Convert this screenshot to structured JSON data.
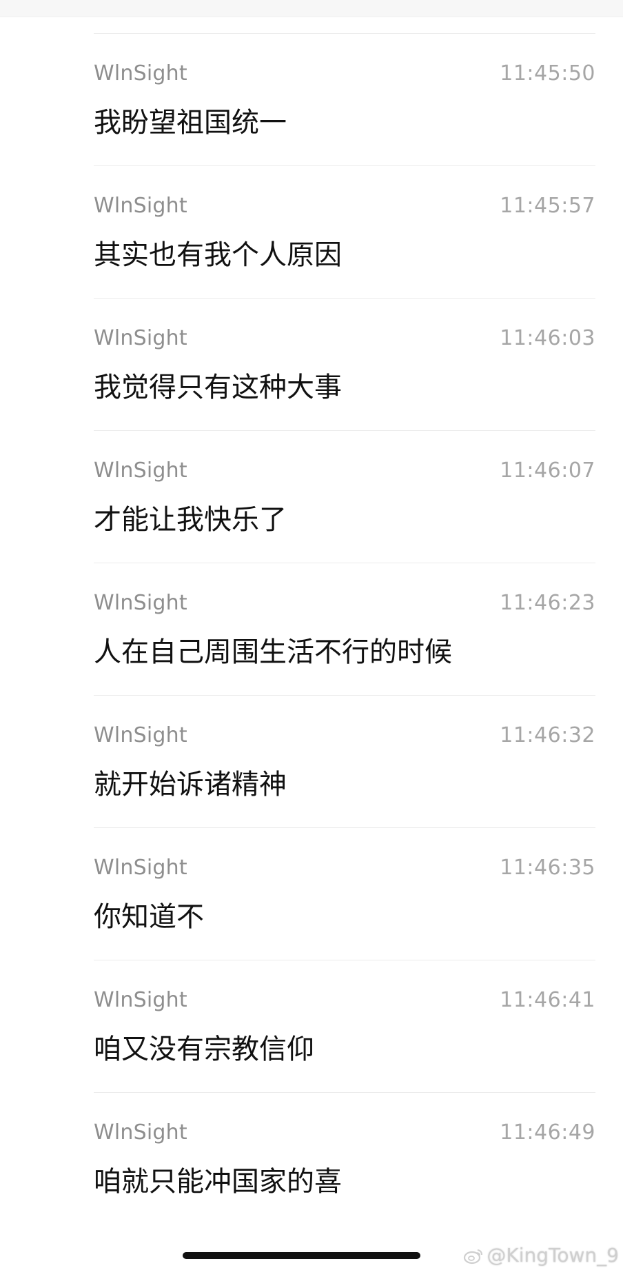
{
  "messages": [
    {
      "sender": "WlnSight",
      "time": "11:45:50",
      "text": "我盼望祖国统一"
    },
    {
      "sender": "WlnSight",
      "time": "11:45:57",
      "text": "其实也有我个人原因"
    },
    {
      "sender": "WlnSight",
      "time": "11:46:03",
      "text": "我觉得只有这种大事"
    },
    {
      "sender": "WlnSight",
      "time": "11:46:07",
      "text": "才能让我快乐了"
    },
    {
      "sender": "WlnSight",
      "time": "11:46:23",
      "text": "人在自己周围生活不行的时候"
    },
    {
      "sender": "WlnSight",
      "time": "11:46:32",
      "text": "就开始诉诸精神"
    },
    {
      "sender": "WlnSight",
      "time": "11:46:35",
      "text": "你知道不"
    },
    {
      "sender": "WlnSight",
      "time": "11:46:41",
      "text": "咱又没有宗教信仰"
    },
    {
      "sender": "WlnSight",
      "time": "11:46:49",
      "text": "咱就只能冲国家的喜"
    }
  ],
  "watermark": {
    "text": "@KingTown_9",
    "icon": "weibo-icon"
  }
}
